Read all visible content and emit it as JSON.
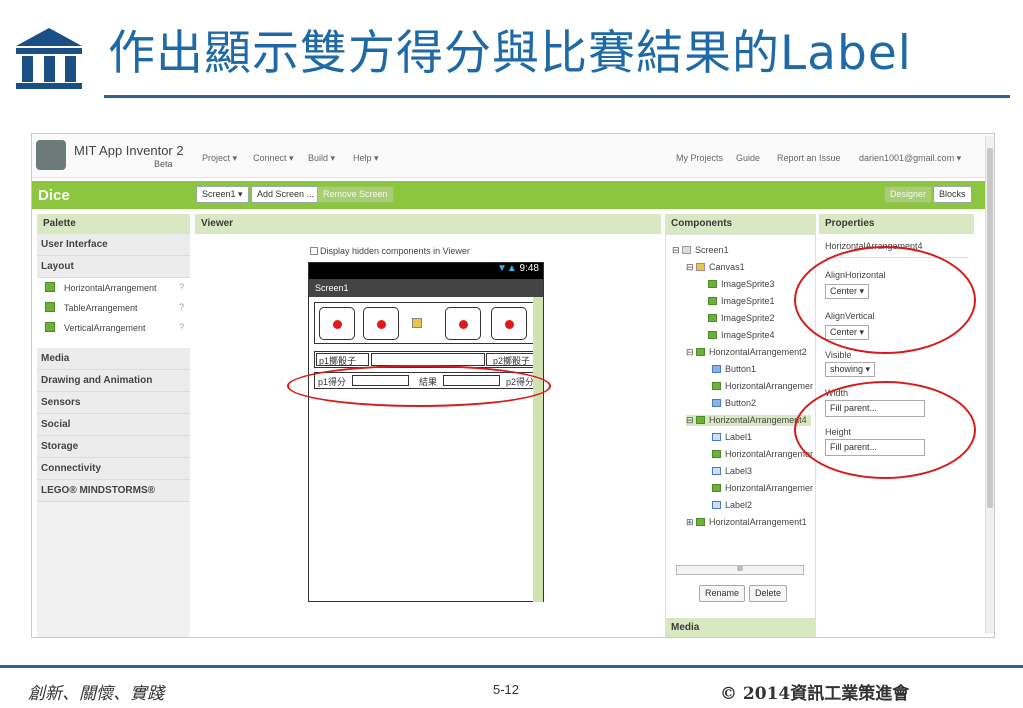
{
  "slide": {
    "title": "作出顯示雙方得分與比賽結果的Label",
    "footer_left": "創新、關懷、實踐",
    "page_number": "5-12",
    "footer_right": "© 2014資訊工業策進會",
    "accent_color": "#1f6aa6"
  },
  "app": {
    "brand": "MIT App Inventor 2",
    "brand_sub": "Beta",
    "menus": [
      "Project ▾",
      "Connect ▾",
      "Build ▾",
      "Help ▾"
    ],
    "right_links": [
      "My Projects",
      "Guide",
      "Report an Issue",
      "darien1001@gmail.com ▾"
    ],
    "project_name": "Dice",
    "screen_select": "Screen1 ▾",
    "add_screen": "Add Screen ...",
    "remove_screen": "Remove Screen",
    "designer": "Designer",
    "blocks": "Blocks",
    "brand_color": "#8cc63f"
  },
  "palette": {
    "heading": "Palette",
    "categories": [
      "User Interface",
      "Layout",
      "Media",
      "Drawing and Animation",
      "Sensors",
      "Social",
      "Storage",
      "Connectivity",
      "LEGO® MINDSTORMS®"
    ],
    "layout_items": [
      "HorizontalArrangement",
      "TableArrangement",
      "VerticalArrangement"
    ],
    "help_icon": "?"
  },
  "viewer": {
    "heading": "Viewer",
    "hidden_checkbox_label": "Display hidden components in Viewer",
    "status_time": "9:48",
    "screen_title": "Screen1",
    "row1_left": "p1擲骰子",
    "row1_right": "p2擲骰子",
    "row2_left": "p1得分",
    "row2_mid": "結果",
    "row2_right": "p2得分"
  },
  "components": {
    "heading": "Components",
    "tree": [
      "Screen1",
      "Canvas1",
      "ImageSprite3",
      "ImageSprite1",
      "ImageSprite2",
      "ImageSprite4",
      "HorizontalArrangement2",
      "Button1",
      "HorizontalArrangemer",
      "Button2",
      "HorizontalArrangement4",
      "Label1",
      "HorizontalArrangemer",
      "Label3",
      "HorizontalArrangemer",
      "Label2",
      "HorizontalArrangement1"
    ],
    "hscroll": "III",
    "rename": "Rename",
    "delete": "Delete",
    "media_heading": "Media"
  },
  "properties": {
    "heading": "Properties",
    "component": "HorizontalArrangement4",
    "align_h_label": "AlignHorizontal",
    "align_h_value": "Center",
    "align_v_label": "AlignVertical",
    "align_v_value": "Center",
    "visible_label": "Visible",
    "visible_value": "showing",
    "width_label": "Width",
    "width_value": "Fill parent...",
    "height_label": "Height",
    "height_value": "Fill parent..."
  }
}
